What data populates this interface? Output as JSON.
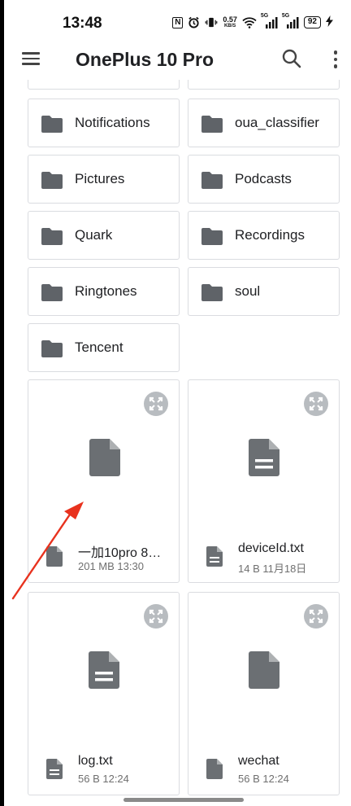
{
  "status_bar": {
    "time": "13:48",
    "nfc": "N",
    "network_speed_value": "0.57",
    "network_speed_unit": "KB/S",
    "signal_1_label": "5G",
    "signal_2_label": "5G",
    "battery": "92"
  },
  "app_bar": {
    "title": "OnePlus 10 Pro"
  },
  "folders": [
    {
      "label": "Notifications"
    },
    {
      "label": "oua_classifier"
    },
    {
      "label": "Pictures"
    },
    {
      "label": "Podcasts"
    },
    {
      "label": "Quark"
    },
    {
      "label": "Recordings"
    },
    {
      "label": "Ringtones"
    },
    {
      "label": "soul"
    },
    {
      "label": "Tencent"
    }
  ],
  "files": [
    {
      "name": "一加10pro 8…",
      "meta": "201 MB 13:30",
      "icon": "file-icon"
    },
    {
      "name": "deviceId.txt",
      "meta": "14 B 11月18日",
      "icon": "text-file-icon"
    },
    {
      "name": "log.txt",
      "meta": "56 B 12:24",
      "icon": "text-file-icon"
    },
    {
      "name": "wechat",
      "meta": "56 B 12:24",
      "icon": "file-icon"
    }
  ],
  "colors": {
    "icon": "#5f6368",
    "expand_circle": "#9aa0a6",
    "annotation_arrow": "#e8321e",
    "border": "#dadce0"
  }
}
